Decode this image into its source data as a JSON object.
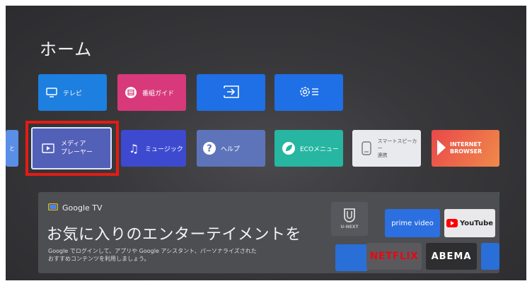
{
  "home": {
    "title": "ホーム"
  },
  "row1": {
    "tv_label": "テレビ",
    "guide_label": "番組ガイド"
  },
  "row2": {
    "partial_label": "と",
    "media_label_line1": "メディア",
    "media_label_line2": "プレーヤー",
    "music_label": "ミュージック",
    "help_label": "ヘルプ",
    "eco_label": "ECOメニュー",
    "speaker_label_line1": "スマートスピーカー",
    "speaker_label_line2": "連携",
    "browser_label_line1": "INTERNET",
    "browser_label_line2": "BROWSER"
  },
  "banner": {
    "brand": "Google TV",
    "headline": "お気に入りのエンターテイメントを",
    "description_line1": "Google でログインして、アプリや Google アシスタント、パーソナライズされた",
    "description_line2": "おすすめコンテンツを利用しましょう。"
  },
  "apps": {
    "unext": "U-NEXT",
    "prime": "prime video",
    "youtube": "YouTube",
    "netflix": "NETFLIX",
    "abema": "ABEMA"
  },
  "colors": {
    "highlight": "#e41b13",
    "tv_tile": "#1d7fe0",
    "guide_tile": "#d8397a",
    "eco_tile": "#26b6a2"
  }
}
